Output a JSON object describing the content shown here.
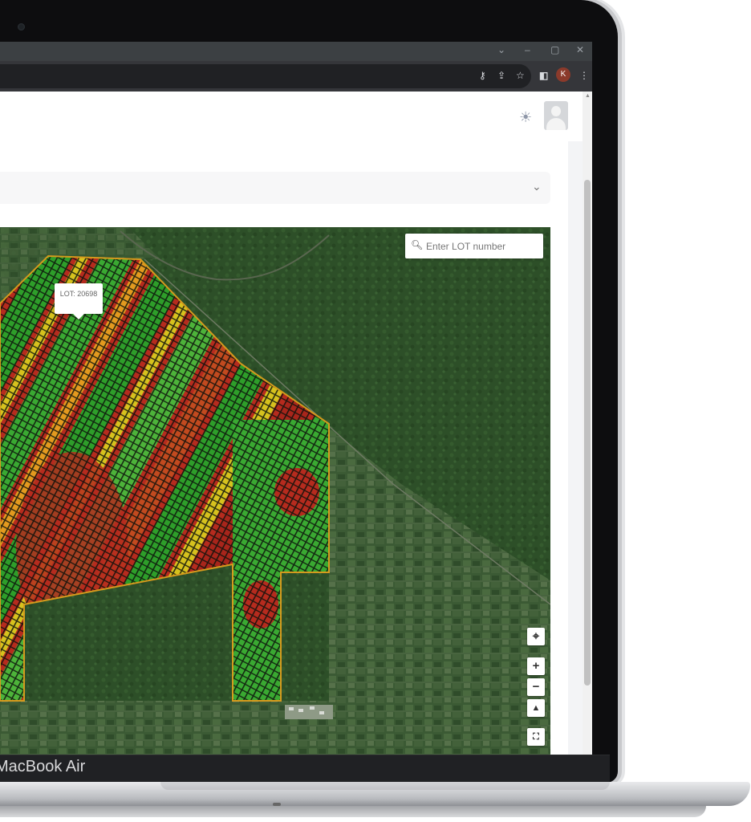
{
  "device": {
    "brand_label": "MacBook Air"
  },
  "browser": {
    "window_controls": [
      "⌄",
      "–",
      "▢",
      "✕"
    ],
    "toolbar_icons": [
      "key-icon",
      "share-icon",
      "star-icon",
      "sidebar-icon",
      "profile-avatar",
      "more-menu-icon"
    ],
    "profile_initial": "K"
  },
  "app": {
    "header": {
      "theme_icon": "sun-icon",
      "avatar": "user-avatar"
    },
    "collapse_bar": {
      "icon": "chevron-down-icon"
    },
    "map": {
      "search": {
        "placeholder": "Enter LOT number",
        "value": ""
      },
      "tooltip": {
        "label": "LOT: 20698"
      },
      "controls": {
        "locate": "⌖",
        "zoom_in": "+",
        "zoom_out": "−",
        "compass": "▲",
        "fullscreen": "⛶"
      },
      "legend_colors": {
        "healthy": "#2e9e2a",
        "moderate": "#d6c21e",
        "stressed": "#b62b1e",
        "forest": "#2d4f28"
      }
    }
  }
}
